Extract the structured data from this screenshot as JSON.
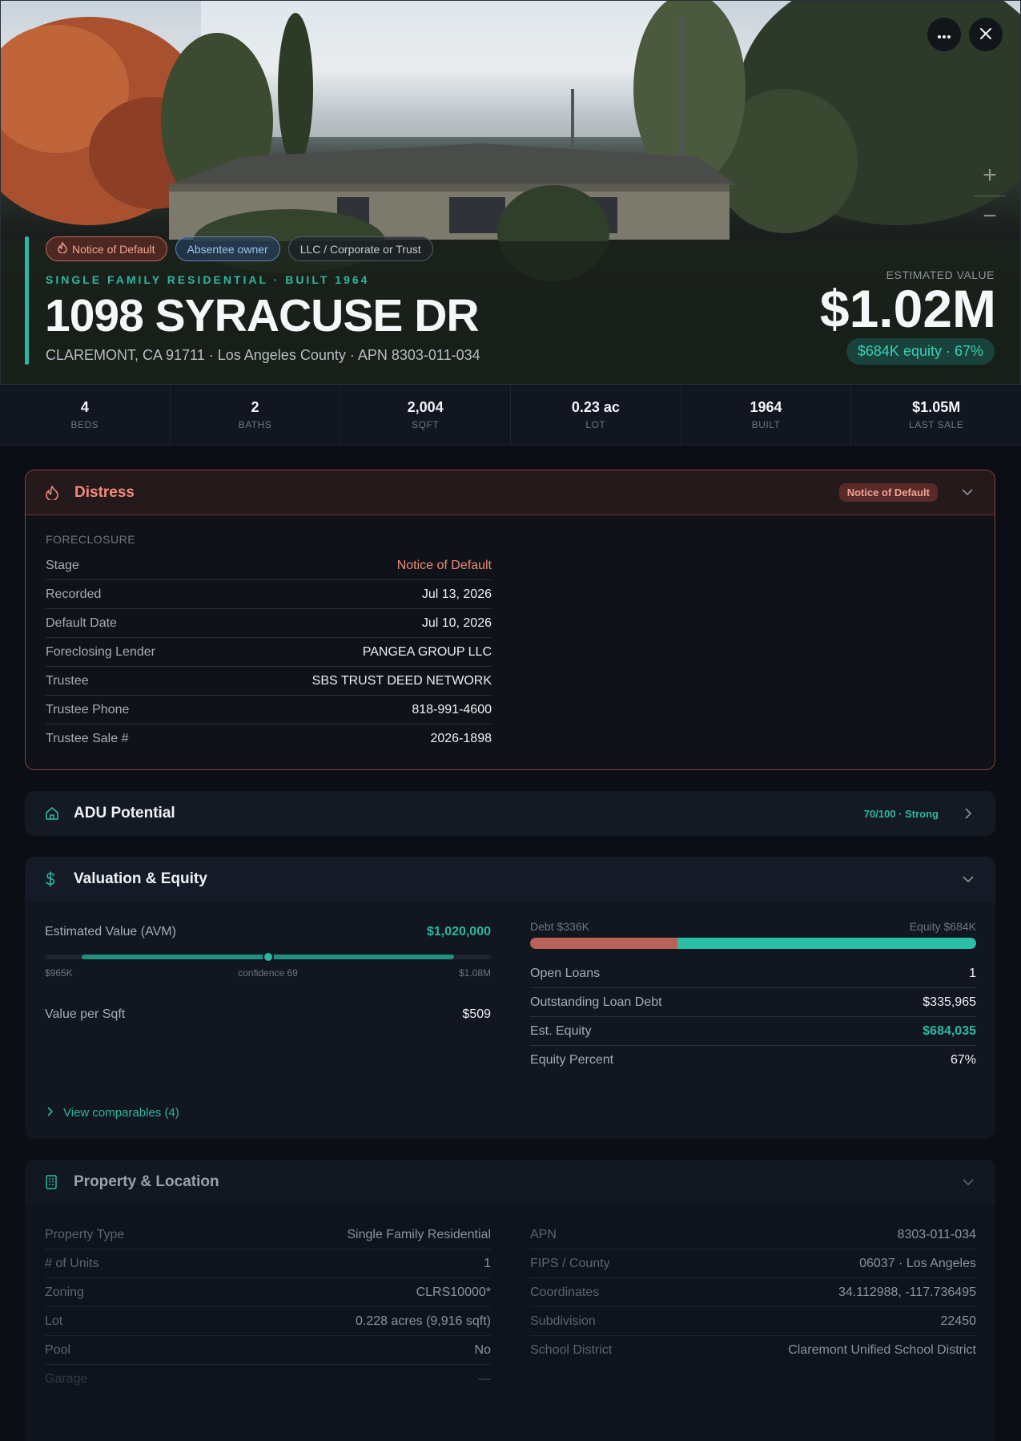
{
  "hero": {
    "chips": [
      {
        "label": "Notice of Default",
        "icon": "flame-icon"
      },
      {
        "label": "Absentee owner"
      },
      {
        "label": "LLC / Corporate or Trust"
      }
    ],
    "subtitle": "SINGLE FAMILY RESIDENTIAL · BUILT 1964",
    "title": "1098 SYRACUSE DR",
    "address": "CLAREMONT, CA 91711 · Los Angeles County · APN 8303-011-034",
    "estimated_label": "ESTIMATED VALUE",
    "estimated_value": "$1.02M",
    "equity_pill": "$684K equity · 67%",
    "accent_color": "#2bb7a0"
  },
  "stats": [
    {
      "value": "4",
      "label": "BEDS"
    },
    {
      "value": "2",
      "label": "BATHS"
    },
    {
      "value": "2,004",
      "label": "SQFT"
    },
    {
      "value": "0.23 ac",
      "label": "LOT"
    },
    {
      "value": "1964",
      "label": "BUILT"
    },
    {
      "value": "$1.05M",
      "label": "LAST SALE"
    }
  ],
  "distress": {
    "title": "Distress",
    "badge": "Notice of Default",
    "section_label": "FORECLOSURE",
    "rows": [
      {
        "k": "Stage",
        "v": "Notice of Default"
      },
      {
        "k": "Recorded",
        "v": "Jul 13, 2026"
      },
      {
        "k": "Default Date",
        "v": "Jul 10, 2026"
      },
      {
        "k": "Foreclosing Lender",
        "v": "PANGEA GROUP LLC"
      },
      {
        "k": "Trustee",
        "v": "SBS TRUST DEED NETWORK"
      },
      {
        "k": "Trustee Phone",
        "v": "818-991-4600"
      },
      {
        "k": "Trustee Sale #",
        "v": "2026-1898"
      }
    ]
  },
  "adu": {
    "title": "ADU Potential",
    "score": "70/100 · Strong"
  },
  "valuation": {
    "title": "Valuation & Equity",
    "avm_label": "Estimated Value (AVM)",
    "avm_value": "$1,020,000",
    "range_low": "$965K",
    "range_high": "$1.08M",
    "confidence": "confidence 69",
    "confidence_position": 0.5,
    "value_per_sqft_label": "Value per Sqft",
    "value_per_sqft": "$509",
    "debt_label": "Debt $336K",
    "equity_label": "Equity $684K",
    "debt_fraction": 0.33,
    "rows": [
      {
        "k": "Open Loans",
        "v": "1"
      },
      {
        "k": "Outstanding Loan Debt",
        "v": "$335,965"
      },
      {
        "k": "Est. Equity",
        "v": "$684,035"
      },
      {
        "k": "Equity Percent",
        "v": "67%"
      }
    ],
    "comparables_link": "View comparables (4)"
  },
  "property": {
    "title": "Property & Location",
    "left_rows": [
      {
        "k": "Property Type",
        "v": "Single Family Residential"
      },
      {
        "k": "# of Units",
        "v": "1"
      },
      {
        "k": "Zoning",
        "v": "CLRS10000*"
      },
      {
        "k": "Lot",
        "v": "0.228 acres (9,916 sqft)"
      },
      {
        "k": "Pool",
        "v": "No"
      },
      {
        "k": "Garage",
        "v": "—"
      }
    ],
    "right_rows": [
      {
        "k": "APN",
        "v": "8303-011-034"
      },
      {
        "k": "FIPS / County",
        "v": "06037 · Los Angeles"
      },
      {
        "k": "Coordinates",
        "v": "34.112988, -117.736495"
      },
      {
        "k": "Subdivision",
        "v": "22450"
      },
      {
        "k": "School District",
        "v": "Claremont Unified School District"
      }
    ]
  }
}
